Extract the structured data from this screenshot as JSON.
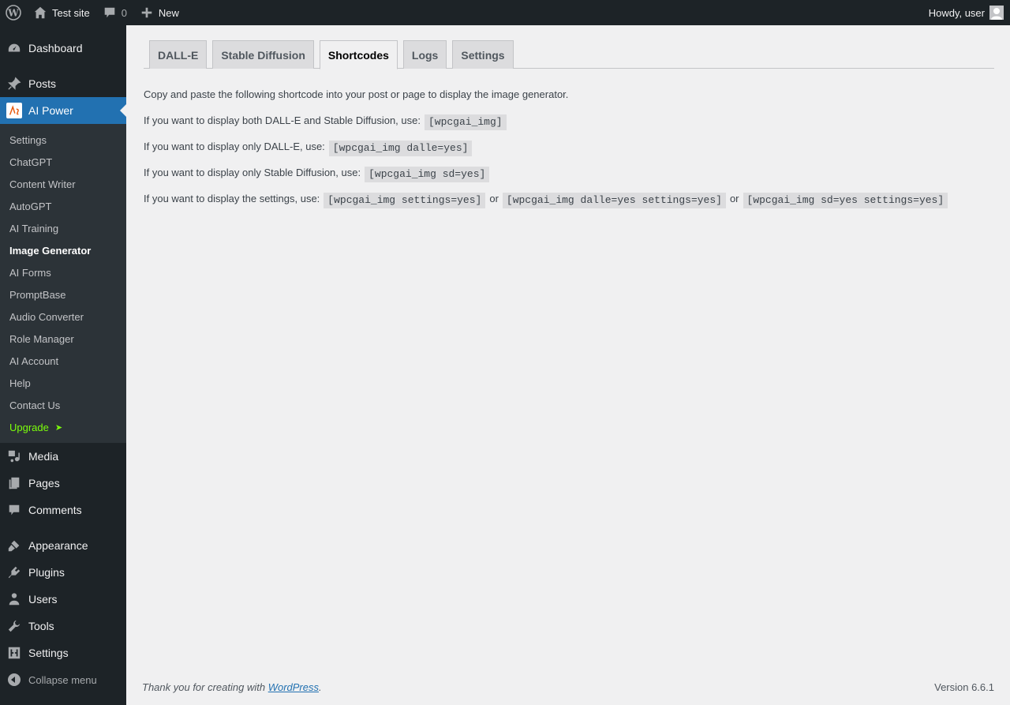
{
  "adminbar": {
    "site_name": "Test site",
    "comments_count": "0",
    "new_label": "New",
    "howdy": "Howdy, user"
  },
  "sidebar": {
    "dashboard": "Dashboard",
    "posts": "Posts",
    "ai_power": "AI Power",
    "submenu": [
      "Settings",
      "ChatGPT",
      "Content Writer",
      "AutoGPT",
      "AI Training",
      "Image Generator",
      "AI Forms",
      "PromptBase",
      "Audio Converter",
      "Role Manager",
      "AI Account",
      "Help",
      "Contact Us"
    ],
    "upgrade": "Upgrade",
    "upgrade_arrow": "➤",
    "media": "Media",
    "pages": "Pages",
    "comments": "Comments",
    "appearance": "Appearance",
    "plugins": "Plugins",
    "users": "Users",
    "tools": "Tools",
    "settings": "Settings",
    "collapse": "Collapse menu"
  },
  "tabs": [
    "DALL-E",
    "Stable Diffusion",
    "Shortcodes",
    "Logs",
    "Settings"
  ],
  "content": {
    "intro": "Copy and paste the following shortcode into your post or page to display the image generator.",
    "both_text": "If you want to display both DALL-E and Stable Diffusion, use:",
    "both_code": "[wpcgai_img]",
    "dalle_text": "If you want to display only DALL-E, use:",
    "dalle_code": "[wpcgai_img dalle=yes]",
    "sd_text": "If you want to display only Stable Diffusion, use:",
    "sd_code": "[wpcgai_img sd=yes]",
    "settings_text": "If you want to display the settings, use:",
    "settings_code1": "[wpcgai_img settings=yes]",
    "or1": "or",
    "settings_code2": "[wpcgai_img dalle=yes settings=yes]",
    "or2": "or",
    "settings_code3": "[wpcgai_img sd=yes settings=yes]"
  },
  "footer": {
    "thanks_prefix": "Thank you for creating with ",
    "link": "WordPress",
    "suffix": ".",
    "version": "Version 6.6.1"
  }
}
